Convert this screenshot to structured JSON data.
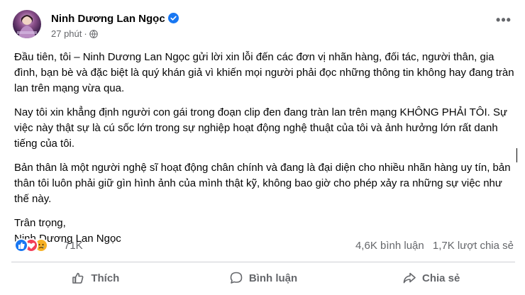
{
  "post": {
    "author": "Ninh Dương Lan Ngọc",
    "time": "27 phút",
    "separator": "·",
    "paragraphs": [
      "Đầu tiên, tôi – Ninh Dương Lan Ngọc gửi lời xin lỗi đến các đơn vị nhãn hàng, đối tác, người thân, gia đình, bạn bè và đặc biệt là quý khán giả vì khiến mọi người phải đọc những thông tin không hay đang tràn lan trên mạng vừa qua.",
      "Nay tôi xin khẳng định người con gái trong đoạn clip đen đang tràn lan trên mạng KHÔNG PHẢI TÔI. Sự việc này thật sự là cú sốc lớn trong sự nghiệp hoạt động nghệ thuật của tôi và ảnh hưởng lớn rất danh tiếng của tôi.",
      "Bản thân là một người nghệ sĩ hoạt động chân chính và đang là đại diện cho nhiều nhãn hàng uy tín, bản thân tôi luôn phải giữ gìn hình ảnh của mình thật kỹ, không bao giờ cho phép xảy ra những sự việc như thế này."
    ],
    "signoff_1": "Trân trọng,",
    "signoff_2": "Ninh Dương Lan Ngọc"
  },
  "reactions": {
    "icons": [
      "like-icon",
      "love-icon",
      "sad-icon"
    ],
    "count": "71K",
    "comments": "4,6K bình luận",
    "shares": "1,7K lượt chia sẻ"
  },
  "actions": {
    "like": "Thích",
    "comment": "Bình luận",
    "share": "Chia sẻ"
  },
  "colors": {
    "like": "#1877f2",
    "love": "#f33e58",
    "sad": "#f7b125",
    "secondary_text": "#65676b",
    "primary_text": "#050505",
    "divider": "#ced0d4"
  }
}
